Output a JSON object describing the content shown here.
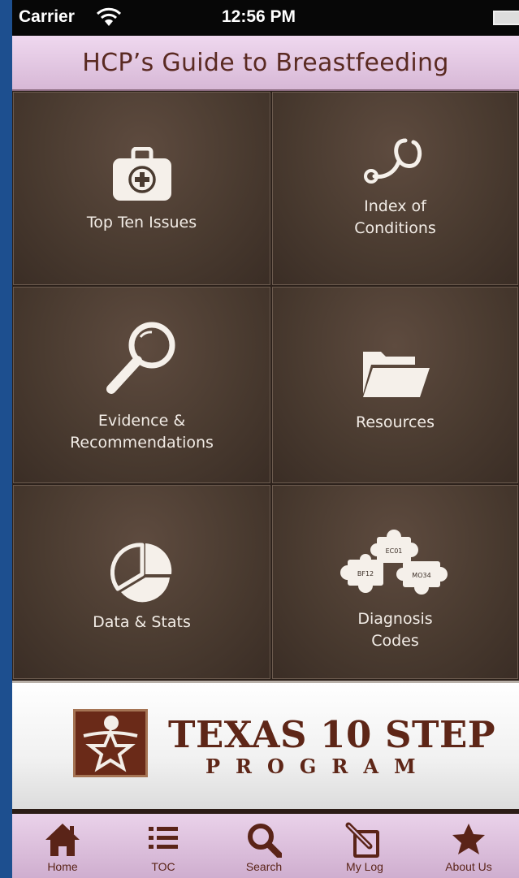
{
  "status_bar": {
    "carrier": "Carrier",
    "time": "12:56 PM"
  },
  "header": {
    "title": "HCP’s Guide to Breastfeeding"
  },
  "menu": {
    "top_ten": "Top Ten Issues",
    "index_line1": "Index of",
    "index_line2": "Conditions",
    "evidence_line1": "Evidence &",
    "evidence_line2": "Recommendations",
    "resources": "Resources",
    "data_stats": "Data & Stats",
    "diagnosis_line1": "Diagnosis",
    "diagnosis_line2": "Codes",
    "puzzle_codes": [
      "EC01",
      "BF12",
      "MO34"
    ]
  },
  "banner": {
    "line1": "TEXAS 10 STEP",
    "line2": "PROGRAM"
  },
  "tabbar": {
    "home": "Home",
    "toc": "TOC",
    "search": "Search",
    "mylog": "My Log",
    "about": "About Us"
  },
  "colors": {
    "title_text": "#5a2a22",
    "tile_bg": "#4a3b30",
    "tab_bg": "#e2c6e2",
    "brand": "#6a2a18"
  }
}
